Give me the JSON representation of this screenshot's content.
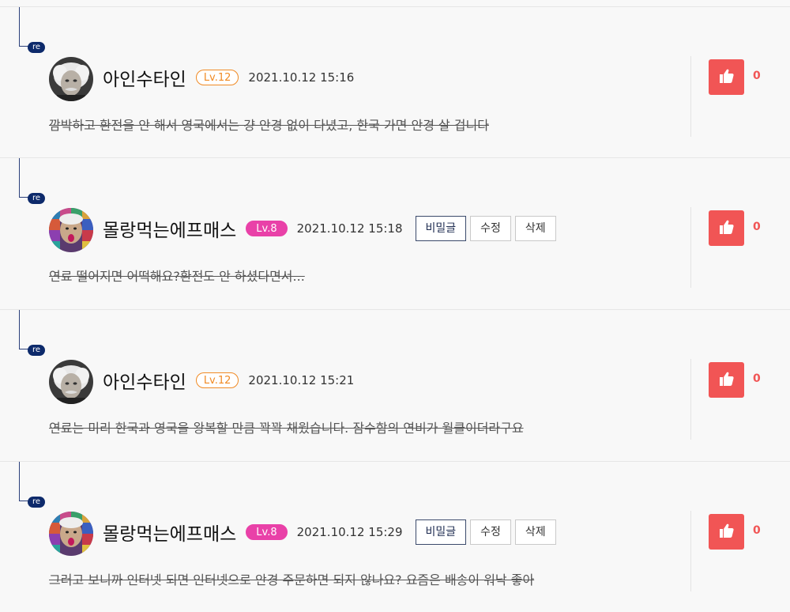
{
  "comments": [
    {
      "badge": "re",
      "nickname": "아인수타인",
      "level": "Lv.12",
      "level_style": "outline",
      "date": "2021.10.12 15:16",
      "body": "깜박하고 환전을 안 해서 영국에서는 걍 안경 없이 다녔고, 한국 가면 안경 살 겁니다",
      "likes": "0",
      "avatar": "einstein-avatar",
      "actions": []
    },
    {
      "badge": "re",
      "nickname": "몰랑먹는에프매스",
      "level": "Lv.8",
      "level_style": "filled",
      "date": "2021.10.12 15:18",
      "body": "연료 떨어지면 어떡해요?환전도 안 하셨다면서...",
      "likes": "0",
      "avatar": "colorful-avatar",
      "actions": [
        "비밀글",
        "수정",
        "삭제"
      ]
    },
    {
      "badge": "re",
      "nickname": "아인수타인",
      "level": "Lv.12",
      "level_style": "outline",
      "date": "2021.10.12 15:21",
      "body": "연료는 미리 한국과 영국을 왕복할 만큼 꽉꽉 채웠습니다. 잠수함의 연비가 월클이더라구요",
      "likes": "0",
      "avatar": "einstein-avatar",
      "actions": []
    },
    {
      "badge": "re",
      "nickname": "몰랑먹는에프매스",
      "level": "Lv.8",
      "level_style": "filled",
      "date": "2021.10.12 15:29",
      "body": "그러고 보니까 인터넷 되면 인터넷으로 안경 주문하면 되지 않나요? 요즘은 배송이 워낙 좋아",
      "likes": "0",
      "avatar": "colorful-avatar",
      "actions": [
        "비밀글",
        "수정",
        "삭제"
      ]
    }
  ],
  "colors": {
    "like": "#f15555",
    "level_outline": "#f08a24",
    "level_filled": "#e941a8",
    "re_badge": "#0d2a6b"
  }
}
